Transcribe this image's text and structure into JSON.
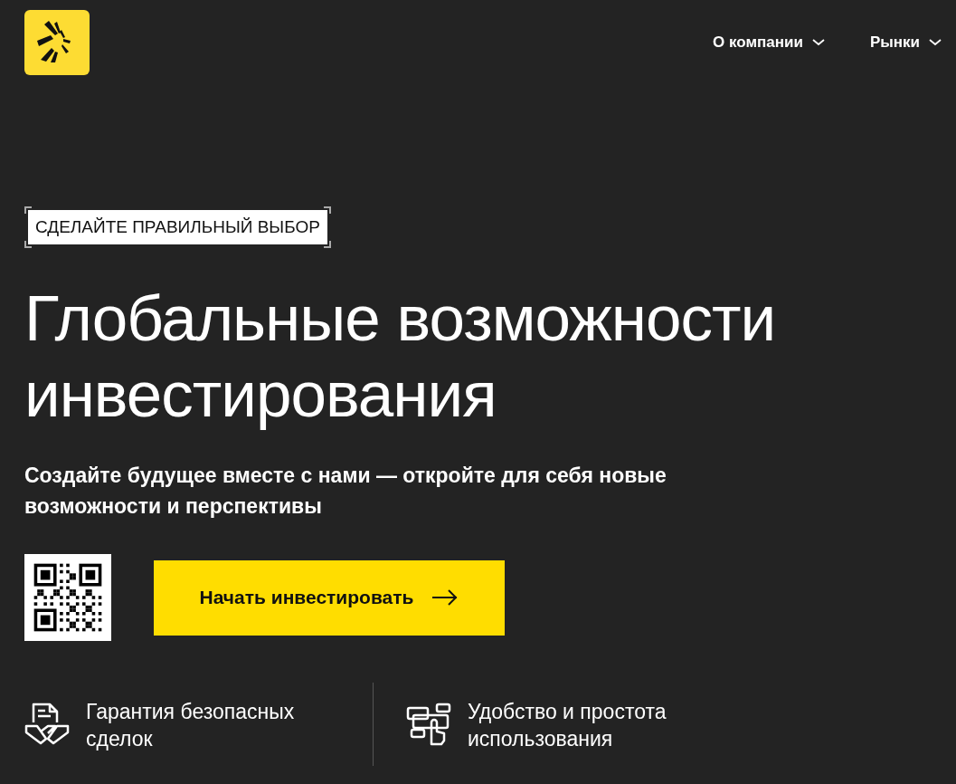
{
  "nav": [
    {
      "label": "О компании"
    },
    {
      "label": "Рынки"
    }
  ],
  "tagline": "СДЕЛАЙТЕ ПРАВИЛЬНЫЙ ВЫБОР",
  "headline": "Глобальные возможности инвестирования",
  "subtitle": "Создайте будущее вместе с нами — откройте для себя новые возможности и перспективы",
  "cta": {
    "label": "Начать инвестировать"
  },
  "features": [
    {
      "kind": "deal",
      "text": "Гарантия безопасных сделок"
    },
    {
      "kind": "ease",
      "text": "Удобство и простота использования"
    }
  ]
}
